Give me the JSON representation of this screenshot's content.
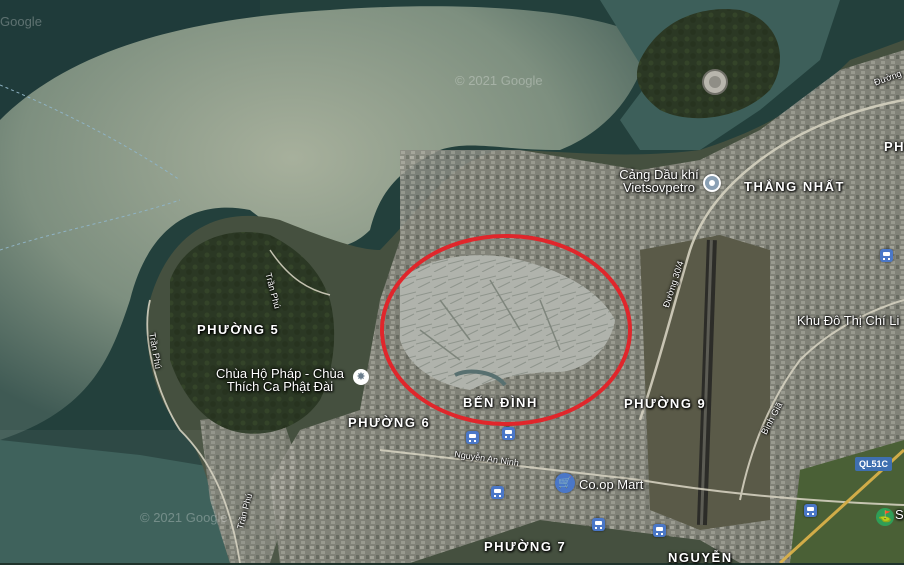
{
  "map": {
    "type": "satellite",
    "colors": {
      "sea": "#25403c",
      "shallows": "#8e9c8a",
      "land": "#3e4a3a",
      "urban": "#8f8f86",
      "forest": "#2d3a26",
      "highlight_circle": "#e0262b"
    },
    "highlight": {
      "shape": "circle",
      "label_inside": "BẾN ĐÌNH"
    }
  },
  "labels": {
    "districts": {
      "phuong_5": "PHƯỜNG 5",
      "phuong_6": "PHƯỜNG 6",
      "phuong_7": "PHƯỜNG 7",
      "phuong_9": "PHƯỜNG 9",
      "ben_dinh": "BẾN ĐÌNH",
      "thang_nhat": "THẮNG NHẤT",
      "nguyen": "NGUYỄN",
      "ph_edge": "PH"
    },
    "pois": {
      "chua": "Chùa Hộ Pháp - Chùa Thích Ca Phật Đài",
      "cang": "Cảng Dầu khí Vietsovpetro",
      "coop": "Co.op Mart",
      "khu_do_thi": "Khu Đô Thị Chí Li",
      "s_edge": "S"
    },
    "streets": {
      "tran_phu_1": "Trần Phú",
      "tran_phu_2": "Trần Phú",
      "tran_phu_3": "Trần Phú",
      "duong_30_4": "Đường 30/4",
      "duong_top": "Đường",
      "nguyen_an_ninh": "Nguyễn An Ninh",
      "binh_gia": "Bình Giã"
    },
    "shields": {
      "ql51c": "QL51C"
    },
    "watermarks": {
      "wm1": "© 2021 Google",
      "wm2": "© 2021 Google",
      "wm3": "Google"
    }
  },
  "icons": [
    "place-pin-icon",
    "temple-icon",
    "bus-stop-icon",
    "shopping-cart-icon",
    "golf-icon"
  ]
}
